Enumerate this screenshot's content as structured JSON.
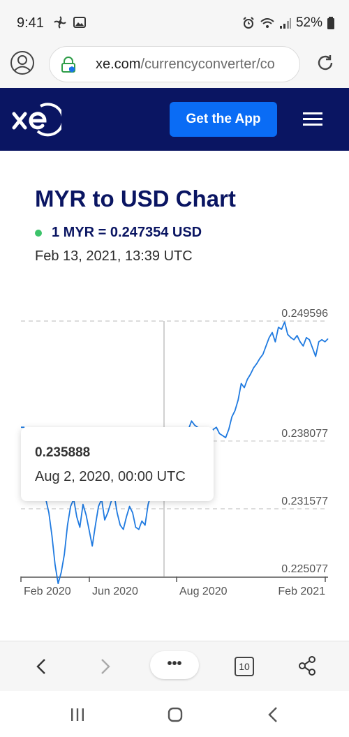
{
  "status_bar": {
    "time": "9:41",
    "battery": "52%"
  },
  "browser": {
    "url_host": "xe.com",
    "url_path": "/currencyconverter/co"
  },
  "header": {
    "get_app_label": "Get the App"
  },
  "main": {
    "title": "MYR to USD Chart",
    "rate": "1 MYR = 0.247354 USD",
    "rate_date": "Feb 13, 2021, 13:39 UTC"
  },
  "tooltip": {
    "value": "0.235888",
    "date": "Aug 2, 2020, 00:00 UTC"
  },
  "chart_data": {
    "type": "line",
    "x_labels": [
      "Feb 2020",
      "Jun 2020",
      "Aug 2020",
      "Feb 2021"
    ],
    "y_ticks": [
      "0.249596",
      "0.238077",
      "0.231577",
      "0.225077"
    ],
    "y_tick_values": [
      0.249596,
      0.238077,
      0.231577,
      0.225077
    ],
    "ylim": [
      0.225077,
      0.249596
    ],
    "series": [
      {
        "values": [
          0.2394,
          0.2394,
          0.2385,
          0.2362,
          0.2372,
          0.238,
          0.2365,
          0.234,
          0.2325,
          0.2312,
          0.229,
          0.2262,
          0.2244,
          0.2255,
          0.2272,
          0.23,
          0.2318,
          0.2325,
          0.2308,
          0.2298,
          0.232,
          0.231,
          0.2295,
          0.228,
          0.23,
          0.2318,
          0.2325,
          0.2305,
          0.2312,
          0.2322,
          0.233,
          0.2312,
          0.23,
          0.2296,
          0.2308,
          0.2318,
          0.2312,
          0.2298,
          0.2296,
          0.2304,
          0.23,
          0.232,
          0.233,
          0.2345,
          0.2352,
          0.2358,
          0.236,
          0.2358,
          0.2368,
          0.2375,
          0.2372,
          0.238,
          0.2378,
          0.2386,
          0.2392,
          0.24,
          0.2396,
          0.2394,
          0.239,
          0.2386,
          0.239,
          0.2386,
          0.2392,
          0.2394,
          0.2388,
          0.2386,
          0.2384,
          0.2392,
          0.2404,
          0.241,
          0.242,
          0.2436,
          0.2432,
          0.244,
          0.2445,
          0.2451,
          0.2455,
          0.246,
          0.2464,
          0.2472,
          0.248,
          0.2485,
          0.2476,
          0.249,
          0.2488,
          0.2495,
          0.2483,
          0.248,
          0.2478,
          0.2482,
          0.2476,
          0.2472,
          0.248,
          0.2478,
          0.247,
          0.2462,
          0.2476,
          0.2478,
          0.2476,
          0.2479
        ]
      }
    ],
    "highlight": {
      "label": "0.235888",
      "date": "Aug 2, 2020, 00:00 UTC"
    },
    "grid": "dashed-horizontal"
  },
  "bottom_nav": {
    "more_label": "•••",
    "tab_count": "10"
  },
  "colors": {
    "brand_navy": "#0a1562",
    "cta_blue": "#0a6cf5",
    "line_blue": "#1f7ae0",
    "live_green": "#3cc36a"
  }
}
